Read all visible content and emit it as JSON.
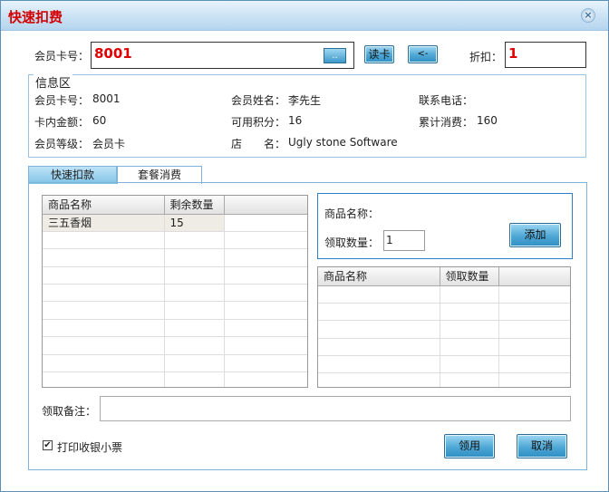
{
  "window": {
    "title": "快速扣费",
    "close_glyph": "×"
  },
  "member_bar": {
    "card_label": "会员卡号：",
    "card_value": "8001",
    "browse_label": "..",
    "read_card_label": "读卡",
    "back_label": "<-",
    "discount_label": "折扣：",
    "discount_value": "1"
  },
  "info": {
    "legend": "信息区",
    "card_no_label": "会员卡号：",
    "card_no": "8001",
    "name_label": "会员姓名：",
    "name": "李先生",
    "phone_label": "联系电话：",
    "phone": "",
    "balance_label": "卡内金额：",
    "balance": "60",
    "points_label": "可用积分：",
    "points": "16",
    "total_label": "累计消费：",
    "total": "160",
    "level_label": "会员等级：",
    "level": "会员卡",
    "store_label": "店　　名：",
    "store": "Ugly stone Software"
  },
  "tabs": [
    {
      "label": "快速扣款"
    },
    {
      "label": "套餐消费"
    }
  ],
  "products_table": {
    "headers": [
      "商品名称",
      "剩余数量"
    ],
    "rows": [
      [
        "三五香烟",
        "15"
      ]
    ]
  },
  "claim_form": {
    "product_label": "商品名称：",
    "product_value": "",
    "qty_label": "领取数量：",
    "qty_value": "1",
    "add_label": "添加"
  },
  "claim_table": {
    "headers": [
      "商品名称",
      "领取数量"
    ]
  },
  "note": {
    "label": "领取备注：",
    "value": ""
  },
  "print_receipt": {
    "label": "打印收银小票",
    "checked": true
  },
  "actions": {
    "ok_label": "领用",
    "cancel_label": "取消"
  },
  "colors": {
    "title": "#d40000",
    "accent": "#2f8ec3",
    "value_red": "#e00000"
  }
}
